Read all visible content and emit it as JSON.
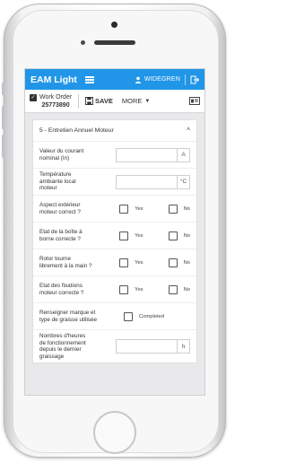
{
  "app": {
    "title": "EAM Light",
    "user": "WIDEGREN"
  },
  "toolbar": {
    "wo_label": "Work Order",
    "wo_number": "25773890",
    "save": "SAVE",
    "more": "MORE"
  },
  "section": {
    "title": "5 - Entretien Annuel Moteur"
  },
  "yes": "Yes",
  "no": "No",
  "completed": "Completed",
  "fields": {
    "courant": {
      "label": "Valeur du courant nominal (In)",
      "unit": "A"
    },
    "temp": {
      "label": "Température ambiante local moteur",
      "unit": "°C"
    },
    "aspect": {
      "label": "Aspect extérieur moteur correct ?"
    },
    "boite": {
      "label": "Etat de la boîte à borne correcte ?"
    },
    "rotor": {
      "label": "Rotor tourne librement à la main ?"
    },
    "fixations": {
      "label": "Etat des fixations moteur correcte ?"
    },
    "graisse": {
      "label": "Renseigner marque et type de graisse utilisée"
    },
    "heures": {
      "label": "Nombres d'heures de fonctionnement depuis le dernier graissage",
      "unit": "h"
    }
  }
}
